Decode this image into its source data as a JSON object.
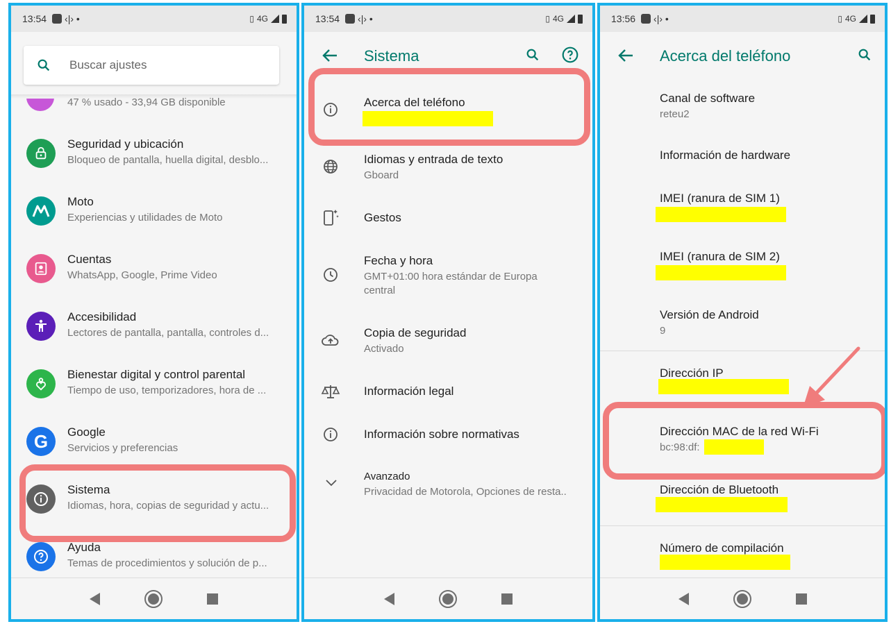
{
  "panels": [
    {
      "status": {
        "time": "13:54",
        "network": "4G"
      },
      "search": {
        "placeholder": "Buscar ajustes"
      },
      "partial_item": {
        "subtitle": "47 % usado - 33,94 GB disponible"
      },
      "items": [
        {
          "title": "Seguridad y ubicación",
          "subtitle": "Bloqueo de pantalla, huella digital, desblo...",
          "icon": "lock-icon",
          "color": "#1e9e55"
        },
        {
          "title": "Moto",
          "subtitle": "Experiencias y utilidades de Moto",
          "icon": "moto-logo-icon",
          "color": "#009b8f"
        },
        {
          "title": "Cuentas",
          "subtitle": "WhatsApp, Google, Prime Video",
          "icon": "account-icon",
          "color": "#e85a8e"
        },
        {
          "title": "Accesibilidad",
          "subtitle": "Lectores de pantalla, pantalla, controles d...",
          "icon": "accessibility-icon",
          "color": "#5b1fb8"
        },
        {
          "title": "Bienestar digital y control parental",
          "subtitle": "Tiempo de uso, temporizadores, hora de ...",
          "icon": "wellbeing-icon",
          "color": "#2db54b"
        },
        {
          "title": "Google",
          "subtitle": "Servicios y preferencias",
          "icon": "google-icon",
          "color": "#1a73e8"
        },
        {
          "title": "Sistema",
          "subtitle": "Idiomas, hora, copias de seguridad y actu...",
          "icon": "info-icon",
          "color": "#616161"
        },
        {
          "title": "Ayuda",
          "subtitle": "Temas de procedimientos y solución de p...",
          "icon": "help-icon",
          "color": "#1a73e8"
        }
      ]
    },
    {
      "status": {
        "time": "13:54",
        "network": "4G"
      },
      "title": "Sistema",
      "items": [
        {
          "title": "Acerca del teléfono",
          "subtitle": "",
          "icon": "info-icon"
        },
        {
          "title": "Idiomas y entrada de texto",
          "subtitle": "Gboard",
          "icon": "globe-icon"
        },
        {
          "title": "Gestos",
          "subtitle": "",
          "icon": "gestures-icon"
        },
        {
          "title": "Fecha y hora",
          "subtitle": "GMT+01:00 hora estándar de Europa",
          "subtitle2": "central",
          "icon": "clock-icon"
        },
        {
          "title": "Copia de seguridad",
          "subtitle": "Activado",
          "icon": "cloud-backup-icon"
        },
        {
          "title": "Información legal",
          "subtitle": "",
          "icon": "scales-icon"
        },
        {
          "title": "Información sobre normativas",
          "subtitle": "",
          "icon": "info-icon"
        },
        {
          "title": "Avanzado",
          "subtitle": "Privacidad de Motorola, Opciones de resta..",
          "icon": "chevron-down-icon"
        }
      ]
    },
    {
      "status": {
        "time": "13:56",
        "network": "4G"
      },
      "title": "Acerca del teléfono",
      "items": [
        {
          "title": "Canal de software",
          "subtitle": "reteu2"
        },
        {
          "title": "Información de hardware",
          "subtitle": ""
        },
        {
          "title": "IMEI (ranura de SIM 1)",
          "subtitle": ""
        },
        {
          "title": "IMEI (ranura de SIM 2)",
          "subtitle": ""
        },
        {
          "title": "Versión de Android",
          "subtitle": "9"
        },
        {
          "title": "Dirección IP",
          "subtitle": ""
        },
        {
          "title": "Dirección MAC de la red Wi-Fi",
          "subtitle": "bc:98:df:"
        },
        {
          "title": "Dirección de Bluetooth",
          "subtitle": ""
        },
        {
          "title": "Número de compilación",
          "subtitle": ""
        }
      ]
    }
  ],
  "colors": {
    "accent": "#00796b",
    "highlight": "#f07c7c",
    "redaction": "#ffff00",
    "frame": "#1ab0ea"
  }
}
